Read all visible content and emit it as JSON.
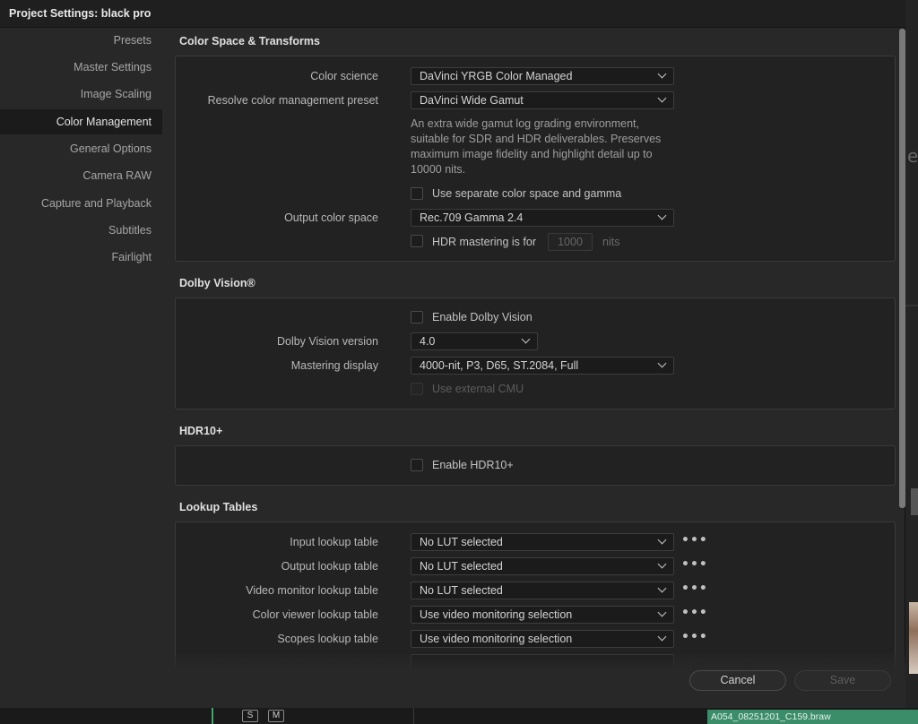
{
  "dialog": {
    "title": "Project Settings:  black pro"
  },
  "sidebar": {
    "items": [
      {
        "label": "Presets"
      },
      {
        "label": "Master Settings"
      },
      {
        "label": "Image Scaling"
      },
      {
        "label": "Color Management"
      },
      {
        "label": "General Options"
      },
      {
        "label": "Camera RAW"
      },
      {
        "label": "Capture and Playback"
      },
      {
        "label": "Subtitles"
      },
      {
        "label": "Fairlight"
      }
    ],
    "active": "Color Management"
  },
  "color_space": {
    "title": "Color Space & Transforms",
    "color_science_label": "Color science",
    "color_science_value": "DaVinci YRGB Color Managed",
    "preset_label": "Resolve color management preset",
    "preset_value": "DaVinci Wide Gamut",
    "description": "An extra wide gamut log grading environment, suitable for SDR and HDR deliverables. Preserves maximum image fidelity and highlight detail up to 10000 nits.",
    "separate_label": "Use separate color space and gamma",
    "output_label": "Output color space",
    "output_value": "Rec.709 Gamma 2.4",
    "hdr_label": "HDR mastering is for",
    "hdr_value": "1000",
    "hdr_unit": "nits"
  },
  "dolby": {
    "title": "Dolby Vision®",
    "enable_label": "Enable Dolby Vision",
    "version_label": "Dolby Vision version",
    "version_value": "4.0",
    "mastering_label": "Mastering display",
    "mastering_value": "4000-nit, P3, D65, ST.2084, Full",
    "external_label": "Use external CMU"
  },
  "hdr10": {
    "title": "HDR10+",
    "enable_label": "Enable HDR10+"
  },
  "luts": {
    "title": "Lookup Tables",
    "rows": [
      {
        "label": "Input lookup table",
        "value": "No LUT selected"
      },
      {
        "label": "Output lookup table",
        "value": "No LUT selected"
      },
      {
        "label": "Video monitor lookup table",
        "value": "No LUT selected"
      },
      {
        "label": "Color viewer lookup table",
        "value": "Use video monitoring selection"
      },
      {
        "label": "Scopes lookup table",
        "value": "Use video monitoring selection"
      }
    ],
    "more_glyph": "•••"
  },
  "footer": {
    "cancel": "Cancel",
    "save": "Save"
  },
  "timeline": {
    "solo": "S",
    "mute": "M",
    "clip_name": "A054_08251201_C159.braw"
  },
  "icons": {
    "dropdown": "chevron-down-icon",
    "more": "more-options-icon"
  }
}
